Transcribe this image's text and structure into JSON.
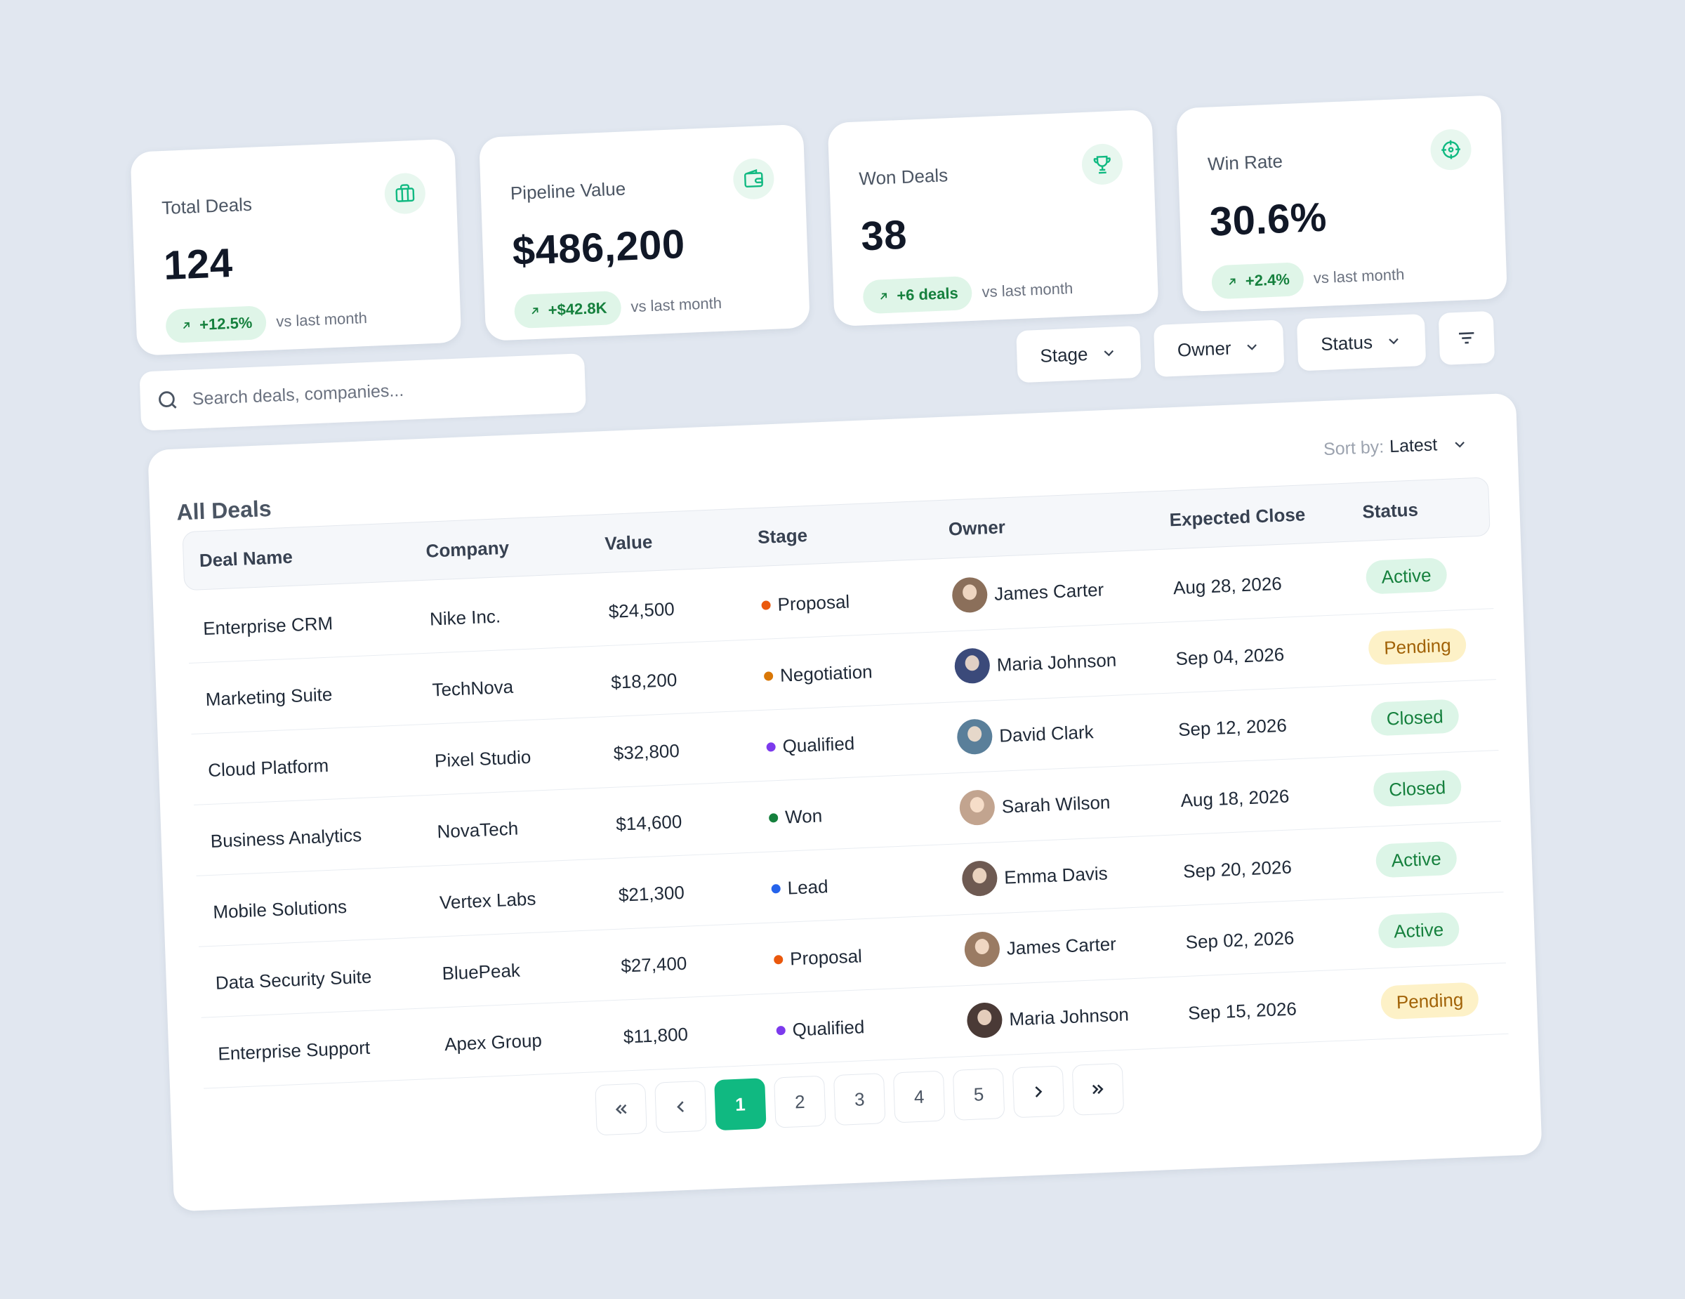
{
  "stats": [
    {
      "label": "Total Deals",
      "value": "124",
      "delta": "+12.5%",
      "vs": "vs last month",
      "icon": "briefcase-icon"
    },
    {
      "label": "Pipeline Value",
      "value": "$486,200",
      "delta": "+$42.8K",
      "vs": "vs last month",
      "icon": "wallet-icon"
    },
    {
      "label": "Won Deals",
      "value": "38",
      "delta": "+6 deals",
      "vs": "vs last month",
      "icon": "trophy-icon"
    },
    {
      "label": "Win Rate",
      "value": "30.6%",
      "delta": "+2.4%",
      "vs": "vs last month",
      "icon": "target-icon"
    }
  ],
  "search": {
    "placeholder": "Search deals, companies..."
  },
  "filters": {
    "stage": "Stage",
    "owner": "Owner",
    "status": "Status"
  },
  "table": {
    "title": "All Deals",
    "sort_label": "Sort by:",
    "sort_value": "Latest",
    "columns": [
      "Deal Name",
      "Company",
      "Value",
      "Stage",
      "Owner",
      "Expected Close",
      "Status"
    ],
    "rows": [
      {
        "deal": "Enterprise CRM",
        "company": "Nike Inc.",
        "value": "$24,500",
        "stage": "Proposal",
        "owner": "James Carter",
        "close": "Aug 28, 2026",
        "status": "Active"
      },
      {
        "deal": "Marketing Suite",
        "company": "TechNova",
        "value": "$18,200",
        "stage": "Negotiation",
        "owner": "Maria Johnson",
        "close": "Sep 04, 2026",
        "status": "Pending"
      },
      {
        "deal": "Cloud Platform",
        "company": "Pixel Studio",
        "value": "$32,800",
        "stage": "Qualified",
        "owner": "David Clark",
        "close": "Sep 12, 2026",
        "status": "Closed"
      },
      {
        "deal": "Business Analytics",
        "company": "NovaTech",
        "value": "$14,600",
        "stage": "Won",
        "owner": "Sarah Wilson",
        "close": "Aug 18, 2026",
        "status": "Closed"
      },
      {
        "deal": "Mobile Solutions",
        "company": "Vertex Labs",
        "value": "$21,300",
        "stage": "Lead",
        "owner": "Emma Davis",
        "close": "Sep 20, 2026",
        "status": "Active"
      },
      {
        "deal": "Data Security Suite",
        "company": "BluePeak",
        "value": "$27,400",
        "stage": "Proposal",
        "owner": "James Carter",
        "close": "Sep 02, 2026",
        "status": "Active"
      },
      {
        "deal": "Enterprise Support",
        "company": "Apex Group",
        "value": "$11,800",
        "stage": "Qualified",
        "owner": "Maria Johnson",
        "close": "Sep 15, 2026",
        "status": "Pending"
      }
    ]
  },
  "pagination": {
    "pages": [
      "1",
      "2",
      "3",
      "4",
      "5"
    ],
    "current": "1"
  },
  "colors": {
    "accent": "#10b981",
    "stage": {
      "Proposal": "#ea580c",
      "Negotiation": "#d97706",
      "Qualified": "#7c3aed",
      "Won": "#15803d",
      "Lead": "#2563eb"
    },
    "status": {
      "Active": {
        "bg": "#dcf5e7",
        "fg": "#15803d"
      },
      "Pending": {
        "bg": "#fdf1c7",
        "fg": "#a16207"
      },
      "Closed": {
        "bg": "#dcf5e7",
        "fg": "#15803d"
      }
    }
  }
}
